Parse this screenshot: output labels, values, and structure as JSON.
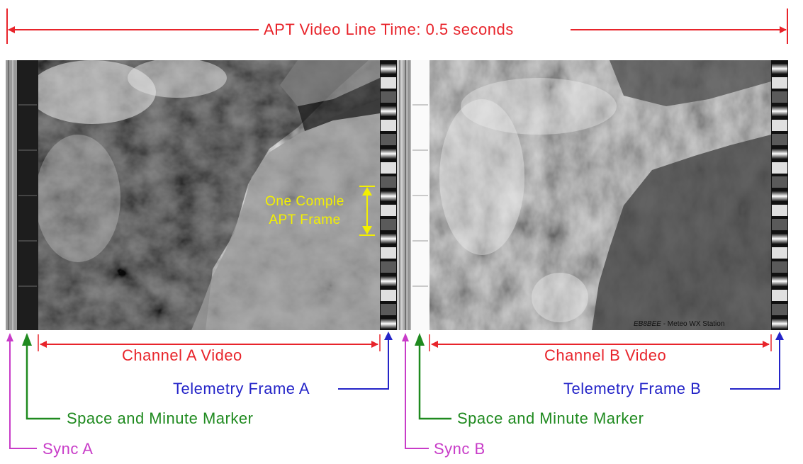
{
  "title": "APT Video Line Time: 0.5 seconds",
  "frame_label_line1": "One Comple",
  "frame_label_line2": "APT Frame",
  "channel_a_video": "Channel A Video",
  "channel_b_video": "Channel B Video",
  "telemetry_a": "Telemetry Frame A",
  "telemetry_b": "Telemetry Frame B",
  "marker_a": "Space and Minute Marker",
  "marker_b": "Space and Minute Marker",
  "sync_a": "Sync A",
  "sync_b": "Sync B",
  "credit_callsign": "EB8BEE",
  "credit_text": " - Meteo WX Station",
  "colors": {
    "red": "#e8242b",
    "green": "#1f8a1f",
    "blue": "#2424c8",
    "magenta": "#c83cc8",
    "yellow": "#f3f000"
  }
}
